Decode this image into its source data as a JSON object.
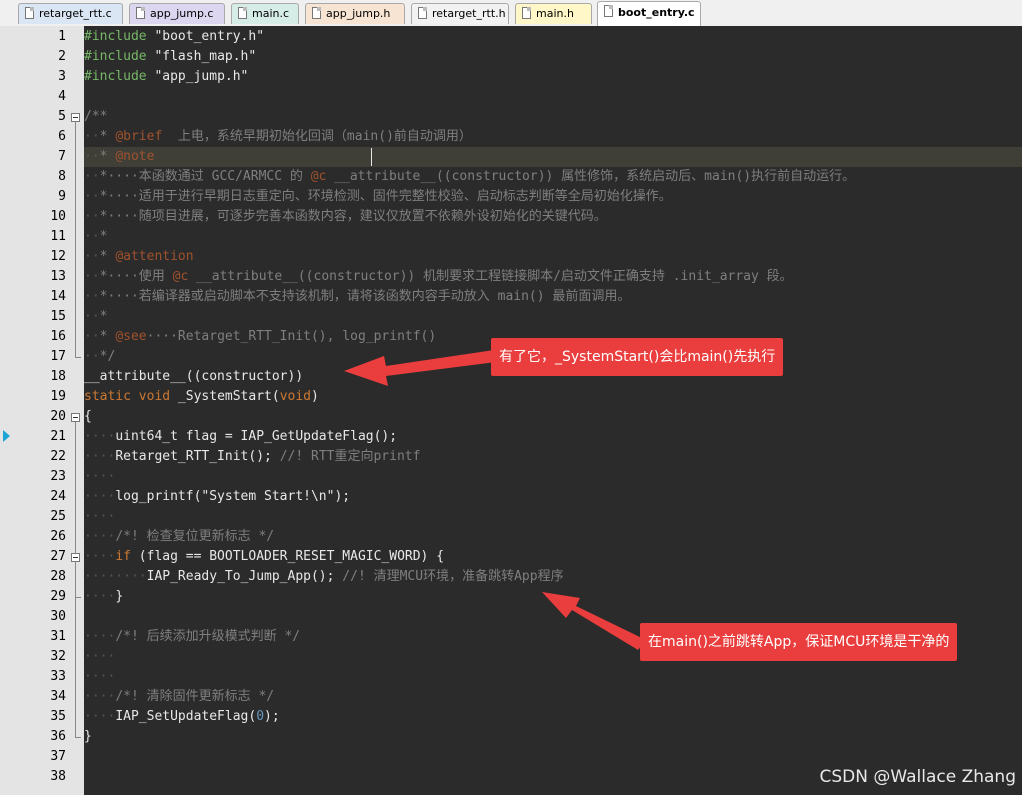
{
  "tabs": [
    {
      "label": "retarget_rtt.c",
      "color": "#dbe6f4"
    },
    {
      "label": "app_jump.c",
      "color": "#dcd6f0"
    },
    {
      "label": "main.c",
      "color": "#d6ece6"
    },
    {
      "label": "app_jump.h",
      "color": "#f8e4d2"
    },
    {
      "label": "retarget_rtt.h",
      "color": "#f2f2f2"
    },
    {
      "label": "main.h",
      "color": "#fff7c8"
    },
    {
      "label": "boot_entry.c",
      "color": "#ffffff",
      "active": true
    }
  ],
  "line_numbers": [
    "1",
    "2",
    "3",
    "4",
    "5",
    "6",
    "7",
    "8",
    "9",
    "10",
    "11",
    "12",
    "13",
    "14",
    "15",
    "16",
    "17",
    "18",
    "19",
    "20",
    "21",
    "22",
    "23",
    "24",
    "25",
    "26",
    "27",
    "28",
    "29",
    "30",
    "31",
    "32",
    "33",
    "34",
    "35",
    "36",
    "37",
    "38"
  ],
  "code": [
    [
      [
        "pp",
        "#include "
      ],
      [
        "str",
        "\"boot_entry.h\""
      ]
    ],
    [
      [
        "pp",
        "#include "
      ],
      [
        "str",
        "\"flash_map.h\""
      ]
    ],
    [
      [
        "pp",
        "#include "
      ],
      [
        "str",
        "\"app_jump.h\""
      ]
    ],
    [],
    [
      [
        "cmt",
        "/**"
      ]
    ],
    [
      [
        "dot",
        "··"
      ],
      [
        "cmt",
        "* "
      ],
      [
        "tag",
        "@brief"
      ],
      [
        "cmt",
        "  上电，系统早期初始化回调（main()前自动调用）"
      ]
    ],
    [
      [
        "dot",
        "··"
      ],
      [
        "cmt",
        "* "
      ],
      [
        "tag",
        "@note"
      ]
    ],
    [
      [
        "dot",
        "··"
      ],
      [
        "cmt",
        "*····本函数通过 GCC/ARMCC 的 "
      ],
      [
        "tag",
        "@c"
      ],
      [
        "cmt",
        " __attribute__((constructor)) 属性修饰，系统启动后、main()执行前自动运行。"
      ]
    ],
    [
      [
        "dot",
        "··"
      ],
      [
        "cmt",
        "*····适用于进行早期日志重定向、环境检测、固件完整性校验、启动标志判断等全局初始化操作。"
      ]
    ],
    [
      [
        "dot",
        "··"
      ],
      [
        "cmt",
        "*····随项目进展，可逐步完善本函数内容，建议仅放置不依赖外设初始化的关键代码。"
      ]
    ],
    [
      [
        "dot",
        "··"
      ],
      [
        "cmt",
        "*"
      ]
    ],
    [
      [
        "dot",
        "··"
      ],
      [
        "cmt",
        "* "
      ],
      [
        "tag",
        "@attention"
      ]
    ],
    [
      [
        "dot",
        "··"
      ],
      [
        "cmt",
        "*····使用 "
      ],
      [
        "tag",
        "@c"
      ],
      [
        "cmt",
        " __attribute__((constructor)) 机制要求工程链接脚本/启动文件正确支持 .init_array 段。"
      ]
    ],
    [
      [
        "dot",
        "··"
      ],
      [
        "cmt",
        "*····若编译器或启动脚本不支持该机制，请将该函数内容手动放入 main() 最前面调用。"
      ]
    ],
    [
      [
        "dot",
        "··"
      ],
      [
        "cmt",
        "*"
      ]
    ],
    [
      [
        "dot",
        "··"
      ],
      [
        "cmt",
        "* "
      ],
      [
        "tag",
        "@see"
      ],
      [
        "cmt",
        "····Retarget_RTT_Init(), log_printf()"
      ]
    ],
    [
      [
        "dot",
        "··"
      ],
      [
        "cmt",
        "*/"
      ]
    ],
    [
      [
        "str",
        "__attribute__((constructor))"
      ]
    ],
    [
      [
        "kw",
        "static"
      ],
      [
        "str",
        " "
      ],
      [
        "kw",
        "void"
      ],
      [
        "str",
        " _SystemStart("
      ],
      [
        "kw",
        "void"
      ],
      [
        "str",
        ")"
      ]
    ],
    [
      [
        "str",
        "{"
      ]
    ],
    [
      [
        "dot",
        "····"
      ],
      [
        "str",
        "uint64_t flag = IAP_GetUpdateFlag();"
      ]
    ],
    [
      [
        "dot",
        "····"
      ],
      [
        "str",
        "Retarget_RTT_Init(); "
      ],
      [
        "cmt",
        "//! RTT重定向printf"
      ]
    ],
    [
      [
        "dot",
        "····"
      ]
    ],
    [
      [
        "dot",
        "····"
      ],
      [
        "str",
        "log_printf(\"System Start!\\n\");"
      ]
    ],
    [
      [
        "dot",
        "····"
      ]
    ],
    [
      [
        "dot",
        "····"
      ],
      [
        "cmt",
        "/*! 检查复位更新标志 */"
      ]
    ],
    [
      [
        "dot",
        "····"
      ],
      [
        "kw",
        "if"
      ],
      [
        "str",
        " (flag == BOOTLOADER_RESET_MAGIC_WORD) {"
      ]
    ],
    [
      [
        "dot",
        "········"
      ],
      [
        "str",
        "IAP_Ready_To_Jump_App(); "
      ],
      [
        "cmt",
        "//! 清理MCU环境，准备跳转App程序"
      ]
    ],
    [
      [
        "dot",
        "····"
      ],
      [
        "str",
        "}"
      ]
    ],
    [],
    [
      [
        "dot",
        "····"
      ],
      [
        "cmt",
        "/*! 后续添加升级模式判断 */"
      ]
    ],
    [
      [
        "dot",
        "····"
      ]
    ],
    [
      [
        "dot",
        "····"
      ]
    ],
    [
      [
        "dot",
        "····"
      ],
      [
        "cmt",
        "/*! 清除固件更新标志 */"
      ]
    ],
    [
      [
        "dot",
        "····"
      ],
      [
        "str",
        "IAP_SetUpdateFlag("
      ],
      [
        "num",
        "0"
      ],
      [
        "str",
        ");"
      ]
    ],
    [
      [
        "str",
        "}"
      ]
    ],
    [],
    []
  ],
  "annotations": {
    "callout1": "有了它，_SystemStart()会比main()先执行",
    "callout2": "在main()之前跳转App，保证MCU环境是干净的"
  },
  "watermark": "CSDN @Wallace Zhang",
  "colors": {
    "editor_bg": "#2b2b2b",
    "callout_red": "#ea3d3d"
  }
}
